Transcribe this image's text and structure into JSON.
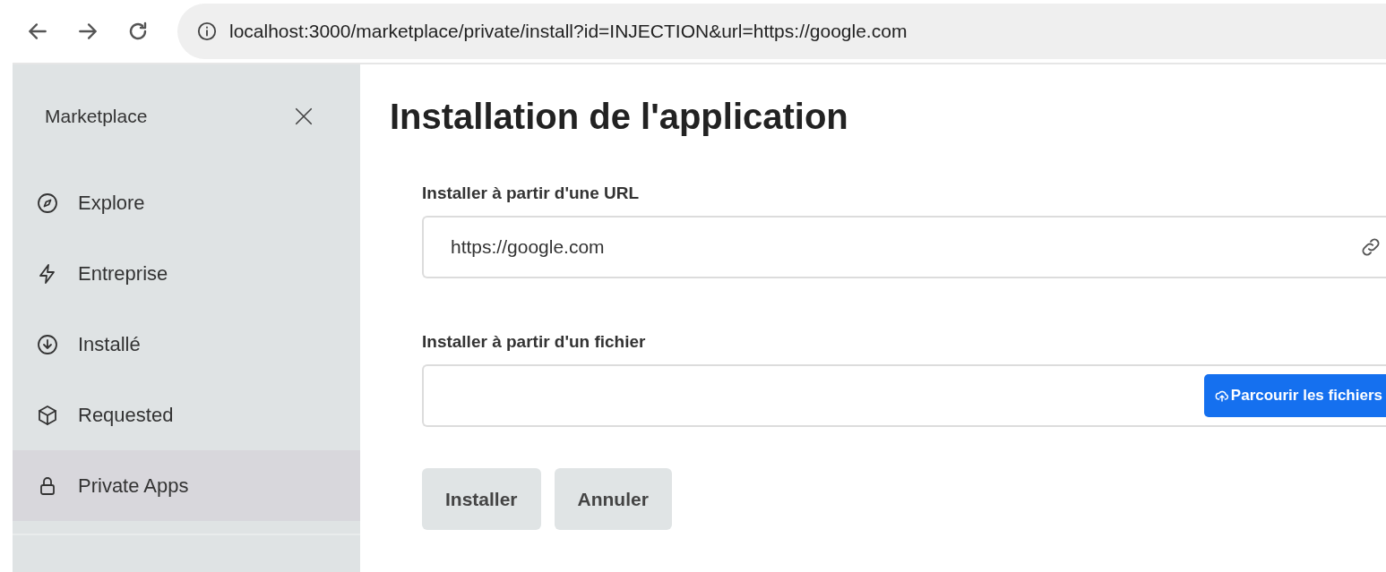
{
  "browser": {
    "url": "localhost:3000/marketplace/private/install?id=INJECTION&url=https://google.com"
  },
  "sidebar": {
    "title": "Marketplace",
    "items": [
      {
        "label": "Explore",
        "kind": "compass",
        "selected": false
      },
      {
        "label": "Entreprise",
        "kind": "bolt",
        "selected": false
      },
      {
        "label": "Installé",
        "kind": "download",
        "selected": false
      },
      {
        "label": "Requested",
        "kind": "box",
        "selected": false
      },
      {
        "label": "Private Apps",
        "kind": "lock",
        "selected": true
      }
    ]
  },
  "main": {
    "title": "Installation de l'application",
    "url_field": {
      "label": "Installer à partir d'une URL",
      "value": "https://google.com"
    },
    "file_field": {
      "label": "Installer à partir d'un fichier",
      "button": "Parcourir les fichiers"
    },
    "buttons": [
      "Installer",
      "Annuler"
    ]
  }
}
